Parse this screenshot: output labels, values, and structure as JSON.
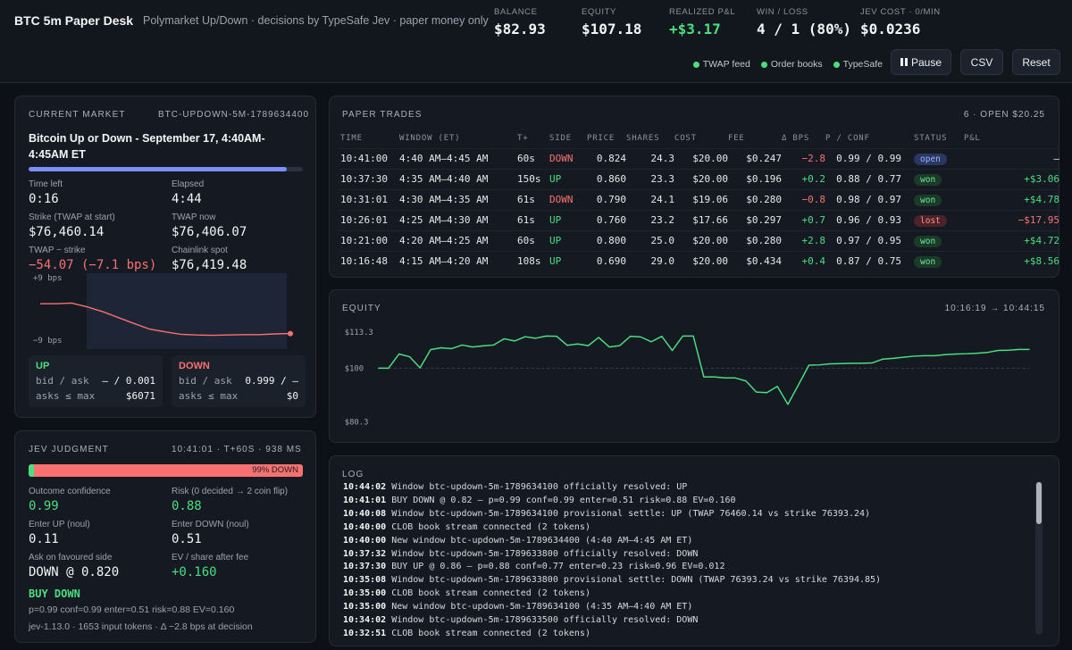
{
  "header": {
    "title": "BTC 5m Paper Desk",
    "subtitle": "Polymarket Up/Down · decisions by TypeSafe Jev · paper money only",
    "stats": [
      {
        "label": "BALANCE",
        "value": "$82.93",
        "color": "#f2f4f6"
      },
      {
        "label": "EQUITY",
        "value": "$107.18",
        "color": "#f2f4f6"
      },
      {
        "label": "REALIZED P&L",
        "value": "+$3.17",
        "color": "#4ade80"
      },
      {
        "label": "WIN / LOSS",
        "value": "4 / 1 (80%)",
        "color": "#f2f4f6"
      },
      {
        "label": "JEV COST · 0/MIN",
        "value": "$0.0236",
        "color": "#f2f4f6"
      }
    ],
    "feeds": [
      "TWAP feed",
      "Order books",
      "TypeSafe"
    ],
    "buttons": {
      "pause": "Pause",
      "csv": "CSV",
      "reset": "Reset"
    }
  },
  "current_market": {
    "heading": "CURRENT MARKET",
    "market_id": "BTC-UPDOWN-5M-1789634400",
    "title": "Bitcoin Up or Down - September 17, 4:40AM-4:45AM ET",
    "progress": 0.94,
    "time_left_label": "Time left",
    "time_left": "0:16",
    "elapsed_label": "Elapsed",
    "elapsed": "4:44",
    "strike_label": "Strike (TWAP at start)",
    "strike": "$76,460.14",
    "twap_now_label": "TWAP now",
    "twap_now": "$76,406.07",
    "twap_diff_label": "TWAP − strike",
    "twap_diff": "−54.07 (−7.1 bps)",
    "chainlink_label": "Chainlink spot",
    "chainlink": "$76,419.48",
    "chart": {
      "top_label": "+9 bps",
      "bottom_label": "−9 bps",
      "bps": [
        1.5,
        1.5,
        1.7,
        0.6,
        -0.8,
        -2.5,
        -4.2,
        -5.8,
        -6.6,
        -7.3,
        -7.5,
        -7.6,
        -7.5,
        -7.4,
        -7.4,
        -7.2,
        -7.1
      ]
    },
    "up": {
      "title": "UP",
      "bid_ask_label": "bid / ask",
      "bid_ask": "– / 0.001",
      "asks_label": "asks ≤ max",
      "asks": "$6071"
    },
    "down": {
      "title": "DOWN",
      "bid_ask_label": "bid / ask",
      "bid_ask": "0.999 / –",
      "asks_label": "asks ≤ max",
      "asks": "$0"
    }
  },
  "jev": {
    "heading": "JEV JUDGMENT",
    "time": "10:41:01 · T+60S · 938 MS",
    "bar_label": "99% DOWN",
    "bar_up_fraction": 0.01,
    "outcome_conf_label": "Outcome confidence",
    "outcome_conf": "0.99",
    "risk_label": "Risk (0 decided → 2 coin flip)",
    "risk": "0.88",
    "enter_up_label": "Enter UP (noul)",
    "enter_up": "0.11",
    "enter_down_label": "Enter DOWN (noul)",
    "enter_down": "0.51",
    "ask_fav_label": "Ask on favoured side",
    "ask_fav": "DOWN @ 0.820",
    "ev_label": "EV / share after fee",
    "ev": "+0.160",
    "decision": "BUY DOWN",
    "detail": "p=0.99 conf=0.99 enter=0.51 risk=0.88 EV=0.160",
    "footer": "jev-1.13.0 · 1653 input tokens · Δ −2.8 bps at decision"
  },
  "trades": {
    "heading": "PAPER TRADES",
    "summary": "6 · OPEN $20.25",
    "columns": [
      "TIME",
      "WINDOW (ET)",
      "T+",
      "SIDE",
      "PRICE",
      "SHARES",
      "COST",
      "FEE",
      "Δ BPS",
      "P / CONF",
      "STATUS",
      "P&L"
    ],
    "rows": [
      {
        "time": "10:41:00",
        "window": "4:40 AM–4:45 AM",
        "t": "60s",
        "side": "DOWN",
        "price": "0.824",
        "shares": "24.3",
        "cost": "$20.00",
        "fee": "$0.247",
        "bps": "−2.8",
        "pconf": "0.99 / 0.99",
        "status": "open",
        "pnl": "–"
      },
      {
        "time": "10:37:30",
        "window": "4:35 AM–4:40 AM",
        "t": "150s",
        "side": "UP",
        "price": "0.860",
        "shares": "23.3",
        "cost": "$20.00",
        "fee": "$0.196",
        "bps": "+0.2",
        "pconf": "0.88 / 0.77",
        "status": "won",
        "pnl": "+$3.06"
      },
      {
        "time": "10:31:01",
        "window": "4:30 AM–4:35 AM",
        "t": "61s",
        "side": "DOWN",
        "price": "0.790",
        "shares": "24.1",
        "cost": "$19.06",
        "fee": "$0.280",
        "bps": "−0.8",
        "pconf": "0.98 / 0.97",
        "status": "won",
        "pnl": "+$4.78"
      },
      {
        "time": "10:26:01",
        "window": "4:25 AM–4:30 AM",
        "t": "61s",
        "side": "UP",
        "price": "0.760",
        "shares": "23.2",
        "cost": "$17.66",
        "fee": "$0.297",
        "bps": "+0.7",
        "pconf": "0.96 / 0.93",
        "status": "lost",
        "pnl": "−$17.95"
      },
      {
        "time": "10:21:00",
        "window": "4:20 AM–4:25 AM",
        "t": "60s",
        "side": "UP",
        "price": "0.800",
        "shares": "25.0",
        "cost": "$20.00",
        "fee": "$0.280",
        "bps": "+2.8",
        "pconf": "0.97 / 0.95",
        "status": "won",
        "pnl": "+$4.72"
      },
      {
        "time": "10:16:48",
        "window": "4:15 AM–4:20 AM",
        "t": "108s",
        "side": "UP",
        "price": "0.690",
        "shares": "29.0",
        "cost": "$20.00",
        "fee": "$0.434",
        "bps": "+0.4",
        "pconf": "0.87 / 0.75",
        "status": "won",
        "pnl": "+$8.56"
      }
    ]
  },
  "equity": {
    "heading": "EQUITY",
    "range": "10:16:19 → 10:44:15",
    "y_labels": [
      "$113.3",
      "$100",
      "$80.3"
    ],
    "y_ticks": [
      113.3,
      100,
      80.3
    ],
    "chart_data": {
      "type": "line",
      "ylim": [
        80.3,
        113.3
      ],
      "baseline": 100,
      "values": [
        100.0,
        100.0,
        105.2,
        104.2,
        100.1,
        106.8,
        107.5,
        107.2,
        108.5,
        107.8,
        108.2,
        108.5,
        110.8,
        110.0,
        111.6,
        111.0,
        111.8,
        111.7,
        108.4,
        108.9,
        108.3,
        111.3,
        107.8,
        108.3,
        111.7,
        111.5,
        109.7,
        111.7,
        106.5,
        111.8,
        111.8,
        96.8,
        96.8,
        96.4,
        96.4,
        95.3,
        91.2,
        91.0,
        93.3,
        86.7,
        93.8,
        101.1,
        101.2,
        101.6,
        101.7,
        101.8,
        101.8,
        101.9,
        103.3,
        103.6,
        104.0,
        104.4,
        104.6,
        104.6,
        105.0,
        105.2,
        105.3,
        105.5,
        105.8,
        106.5,
        106.6,
        106.9,
        106.9
      ]
    }
  },
  "log": {
    "heading": "LOG",
    "lines": [
      {
        "t": "10:44:02",
        "m": "Window btc-updown-5m-1789634100 officially resolved: UP"
      },
      {
        "t": "10:41:01",
        "m": "BUY DOWN @ 0.82 — p=0.99 conf=0.99 enter=0.51 risk=0.88 EV=0.160"
      },
      {
        "t": "10:40:08",
        "m": "Window btc-updown-5m-1789634100 provisional settle: UP (TWAP 76460.14 vs strike 76393.24)"
      },
      {
        "t": "10:40:00",
        "m": "CLOB book stream connected (2 tokens)"
      },
      {
        "t": "10:40:00",
        "m": "New window btc-updown-5m-1789634400 (4:40 AM–4:45 AM ET)"
      },
      {
        "t": "10:37:32",
        "m": "Window btc-updown-5m-1789633800 officially resolved: DOWN"
      },
      {
        "t": "10:37:30",
        "m": "BUY UP @ 0.86 — p=0.88 conf=0.77 enter=0.23 risk=0.96 EV=0.012"
      },
      {
        "t": "10:35:08",
        "m": "Window btc-updown-5m-1789633800 provisional settle: DOWN (TWAP 76393.24 vs strike 76394.85)"
      },
      {
        "t": "10:35:00",
        "m": "CLOB book stream connected (2 tokens)"
      },
      {
        "t": "10:35:00",
        "m": "New window btc-updown-5m-1789634100 (4:35 AM–4:40 AM ET)"
      },
      {
        "t": "10:34:02",
        "m": "Window btc-updown-5m-1789633500 officially resolved: DOWN"
      },
      {
        "t": "10:32:51",
        "m": "CLOB book stream connected (2 tokens)"
      }
    ]
  },
  "colors": {
    "accent": "#7c8ff5",
    "up": "#4ade80",
    "down": "#f87171",
    "background": "#0d1117",
    "panel": "#151a22"
  }
}
